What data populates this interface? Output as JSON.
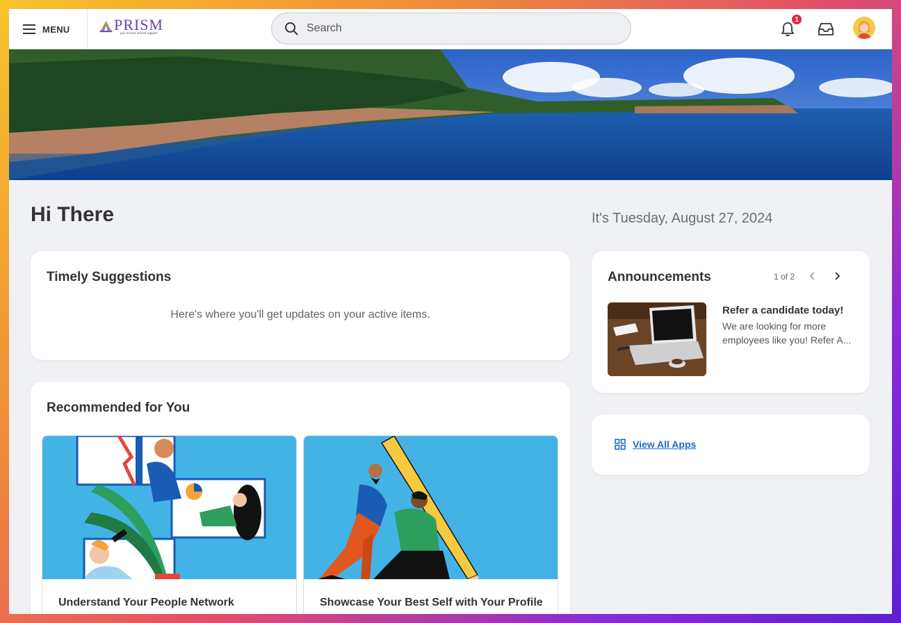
{
  "header": {
    "menu_label": "MENU",
    "logo_text": "PRISM",
    "logo_tagline": "pay reward inform support",
    "search_placeholder": "Search",
    "notification_count": "1"
  },
  "hero": {
    "greeting": "Hi There",
    "date_text": "It's Tuesday, August 27, 2024"
  },
  "timely": {
    "title": "Timely Suggestions",
    "empty_text": "Here's where you'll get updates on your active items."
  },
  "recommended": {
    "title": "Recommended for You",
    "items": [
      {
        "title": "Understand Your People Network"
      },
      {
        "title": "Showcase Your Best Self with Your Profile"
      }
    ]
  },
  "announcements": {
    "title": "Announcements",
    "pager": "1 of 2",
    "item": {
      "title": "Refer a candidate today!",
      "text": "We are looking for more employees like you! Refer A..."
    }
  },
  "apps": {
    "link_label": "View All Apps"
  },
  "colors": {
    "accent_link": "#1b6fbd",
    "badge": "#de2c3a",
    "tile_bg": "#43b3e6",
    "page_bg": "#f0f1f4"
  },
  "icons": [
    "menu-icon",
    "search-icon",
    "bell-icon",
    "inbox-icon",
    "chevron-left-icon",
    "chevron-right-icon",
    "grid-icon"
  ]
}
